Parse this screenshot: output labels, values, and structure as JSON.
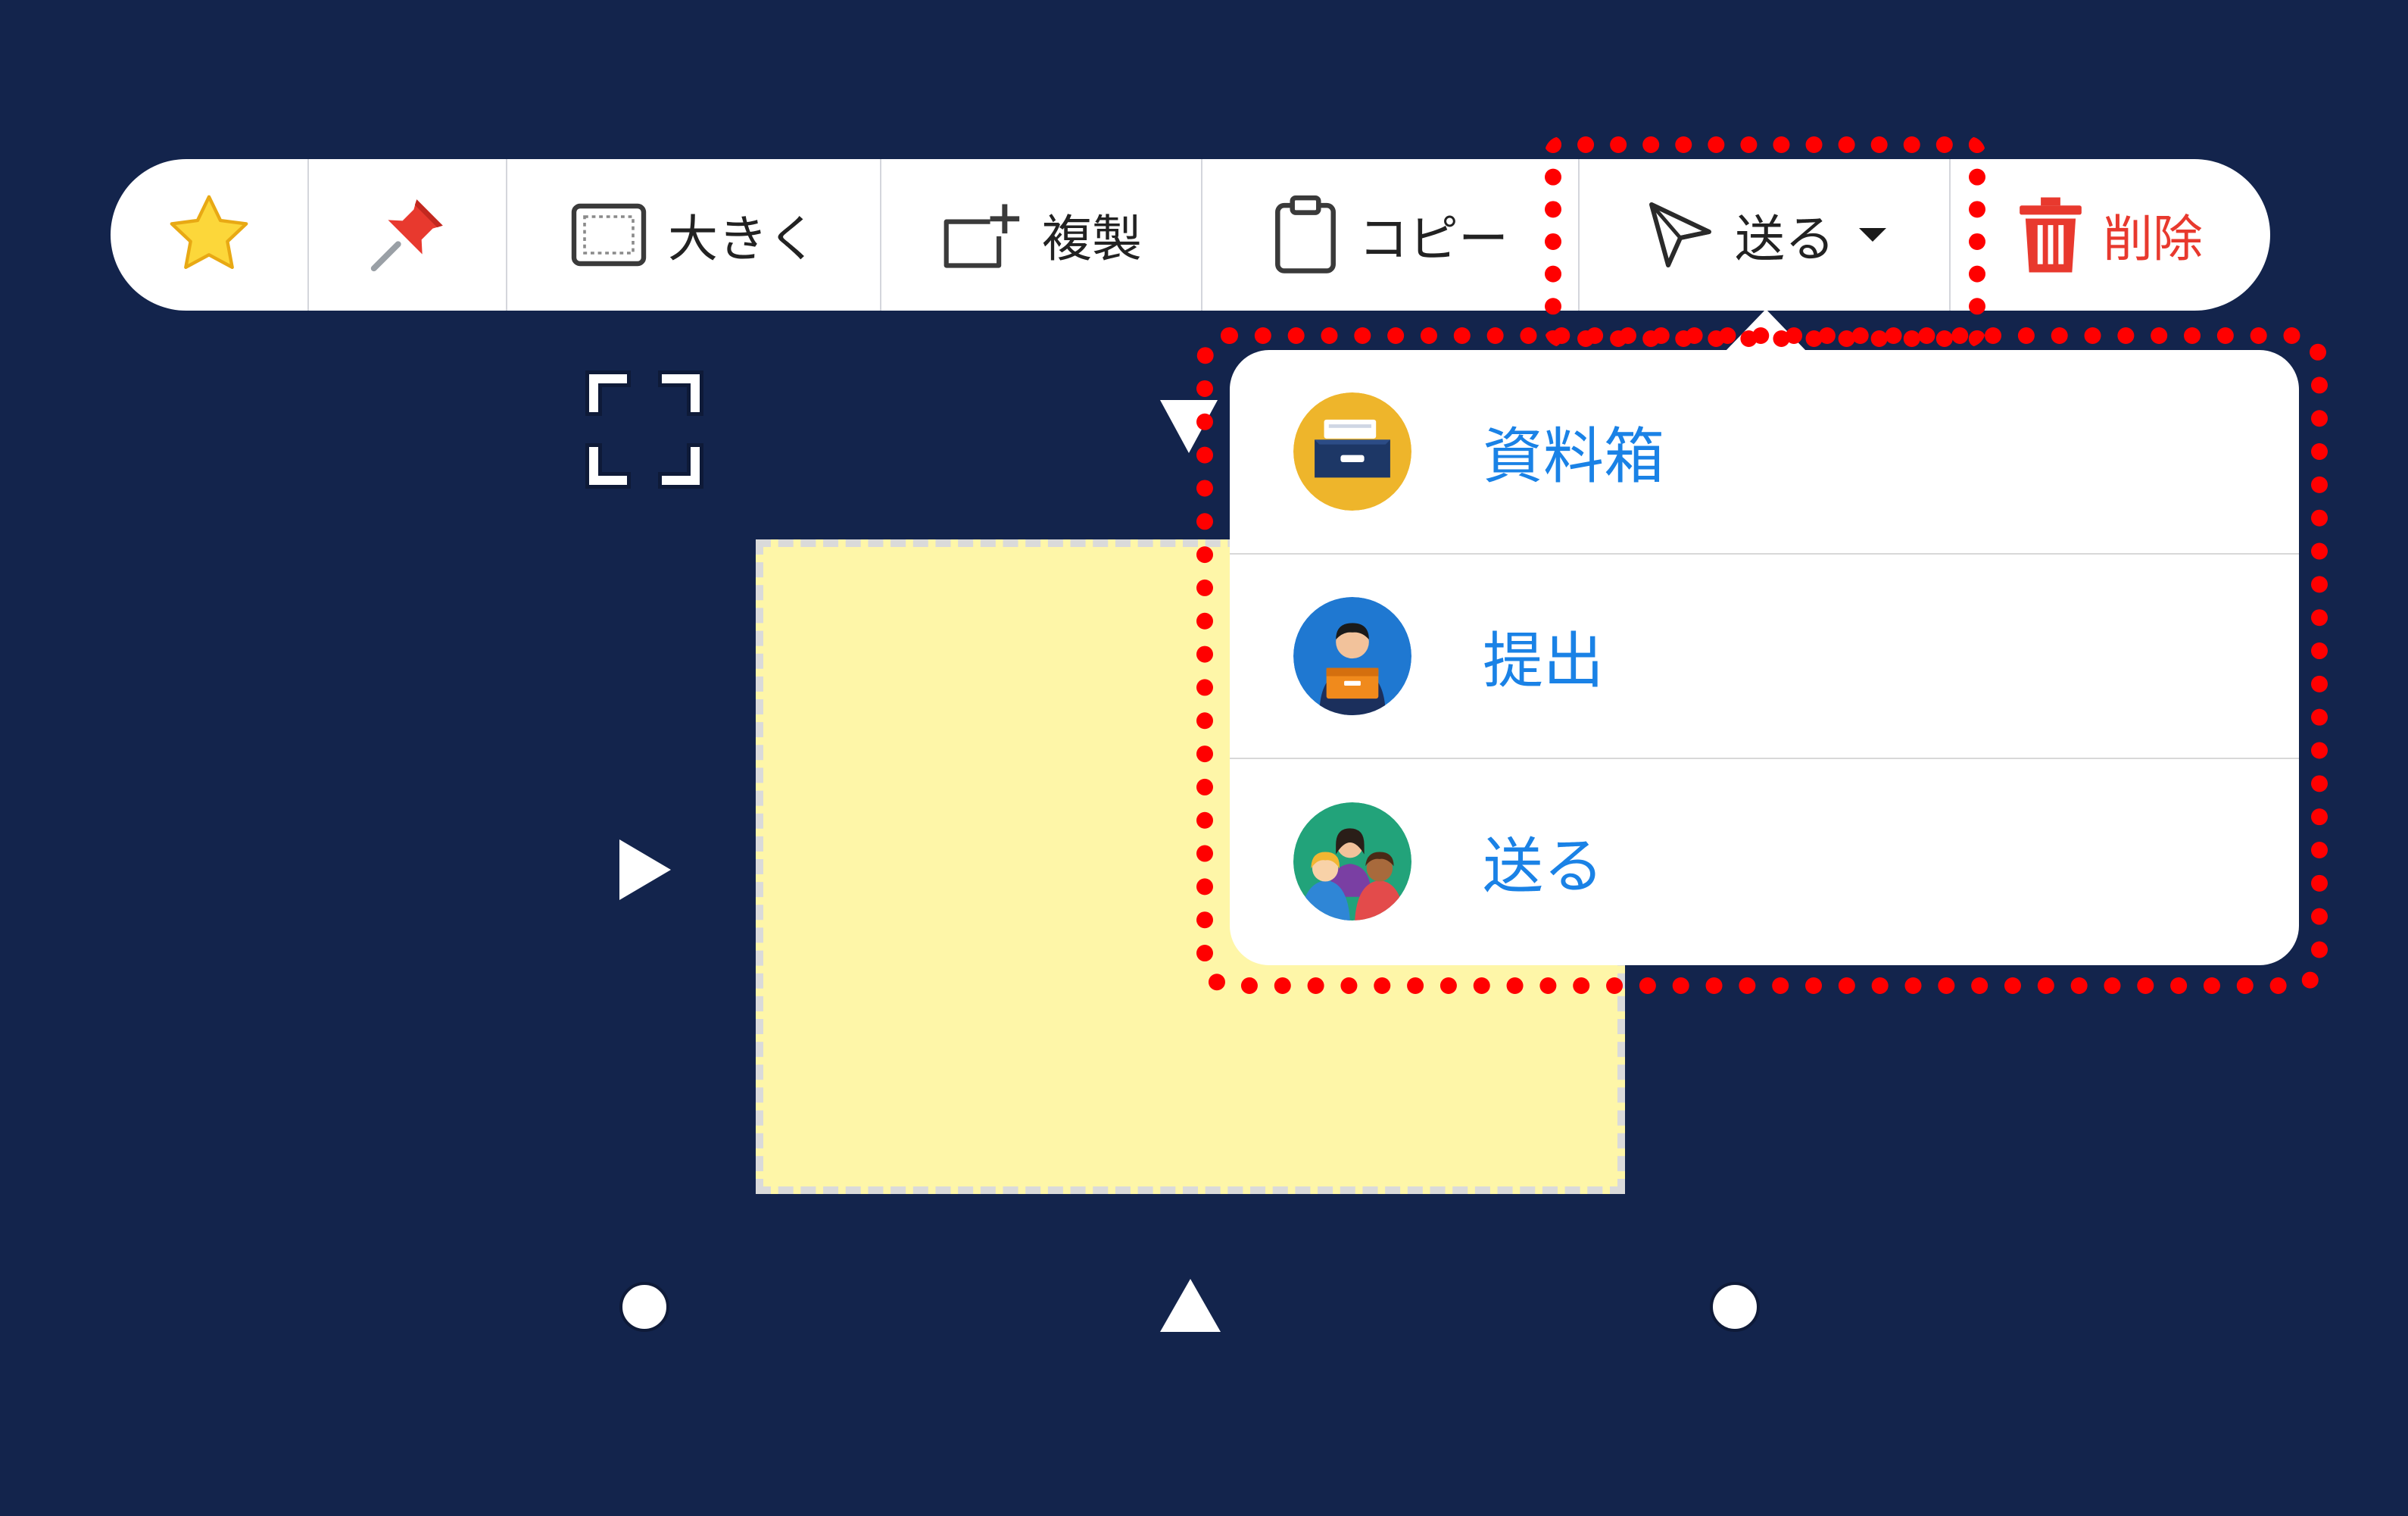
{
  "toolbar": {
    "items": [
      {
        "id": "star",
        "icon": "star-icon",
        "label": ""
      },
      {
        "id": "pin",
        "icon": "pushpin-icon",
        "label": ""
      },
      {
        "id": "enlarge",
        "icon": "enlarge-frame-icon",
        "label": "大きく"
      },
      {
        "id": "duplicate",
        "icon": "duplicate-plus-icon",
        "label": "複製"
      },
      {
        "id": "copy",
        "icon": "clipboard-icon",
        "label": "コピー"
      },
      {
        "id": "send",
        "icon": "paper-plane-icon",
        "label": "送る"
      },
      {
        "id": "delete",
        "icon": "trash-icon",
        "label": "削除"
      }
    ]
  },
  "send_menu": {
    "items": [
      {
        "icon": "file-drawer-icon",
        "label": "資料箱"
      },
      {
        "icon": "person-with-box-icon",
        "label": "提出"
      },
      {
        "icon": "group-people-icon",
        "label": "送る"
      }
    ]
  },
  "colors": {
    "background": "#13244c",
    "toolbar": "#ffffff",
    "delete_red": "#e8392e",
    "menu_text_blue": "#1a82e6",
    "highlight_red": "#ff0000",
    "sticky_note": "#fef6a8"
  }
}
